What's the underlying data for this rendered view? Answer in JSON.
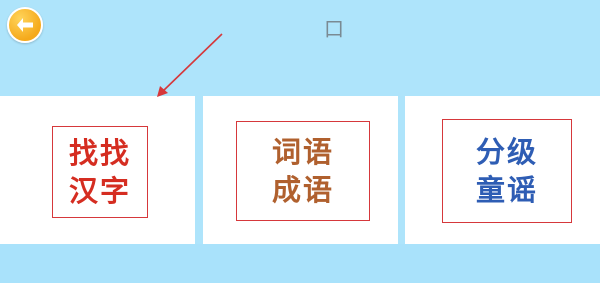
{
  "header": {
    "back_icon": "back-arrow-icon",
    "title": "口"
  },
  "cards": [
    {
      "line1": "找找",
      "line2": "汉字"
    },
    {
      "line1": "词语",
      "line2": "成语"
    },
    {
      "line1": "分级",
      "line2": "童谣"
    }
  ],
  "colors": {
    "background": "#aee4fb",
    "back_button": "#f5a91b",
    "box_border": "#d6383b",
    "card1_text": "#d52d21",
    "card2_text": "#b0602e",
    "card3_text": "#2e5db4",
    "annotation_arrow": "#d6383b"
  }
}
